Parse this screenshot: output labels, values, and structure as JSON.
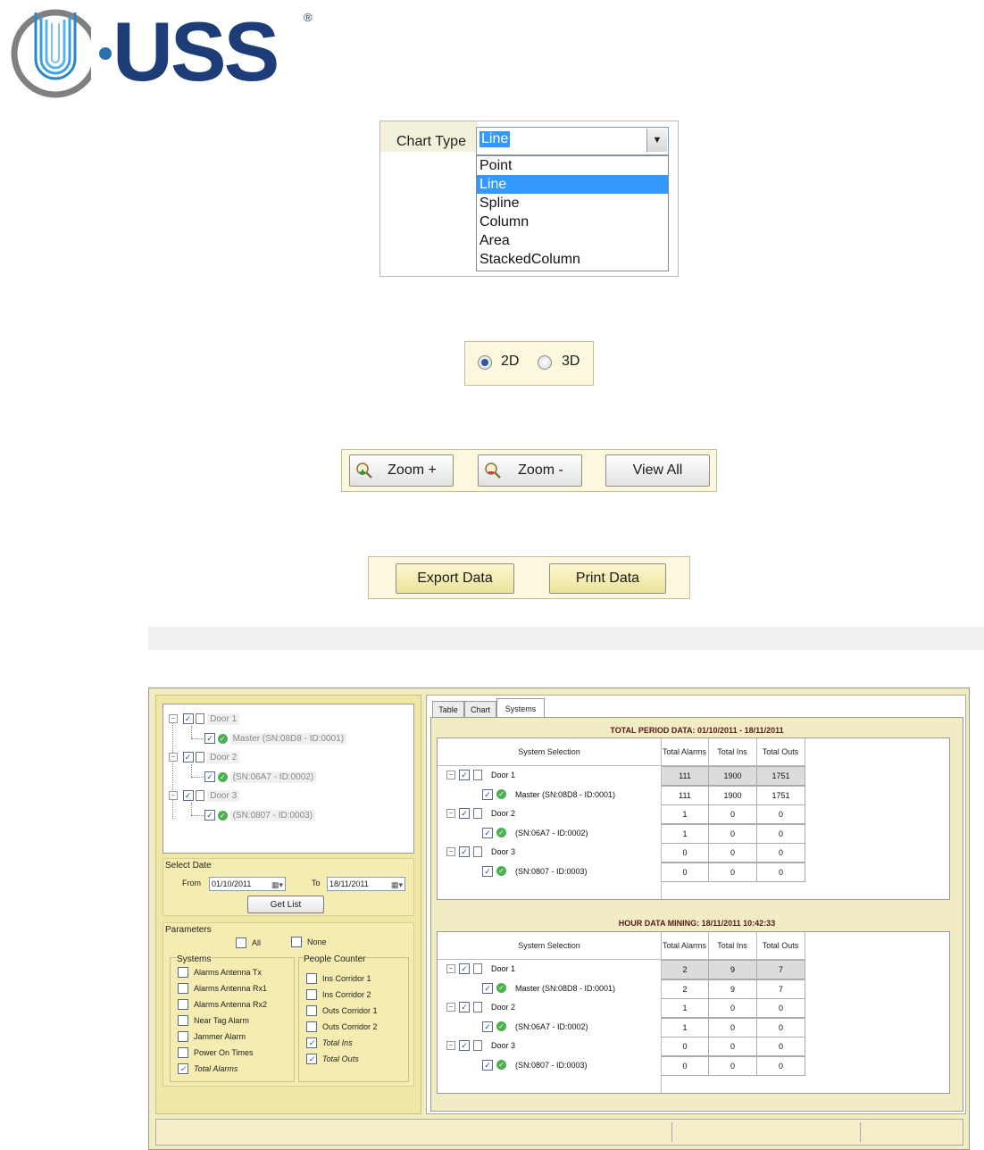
{
  "logo": {
    "text": "USS",
    "reg": "®"
  },
  "chart_type": {
    "label": "Chart Type",
    "value": "Line",
    "options": [
      "Point",
      "Line",
      "Spline",
      "Column",
      "Area",
      "StackedColumn"
    ],
    "selected_index": 1
  },
  "dimension": {
    "option_2d": "2D",
    "option_3d": "3D",
    "selected": "2D"
  },
  "zoom": {
    "zoom_in": "Zoom +",
    "zoom_out": "Zoom -",
    "view_all": "View All"
  },
  "export": {
    "export_label": "Export Data",
    "print_label": "Print Data"
  },
  "app": {
    "tree": [
      {
        "label": "Door 1",
        "child": "Master (SN:08D8 - ID:0001)"
      },
      {
        "label": "Door 2",
        "child": "(SN:06A7 - ID:0002)"
      },
      {
        "label": "Door 3",
        "child": "(SN:0807 - ID:0003)"
      }
    ],
    "select_date": {
      "title": "Select Date",
      "from_label": "From",
      "from_value": "01/10/2011",
      "to_label": "To",
      "to_value": "18/11/2011",
      "get_list": "Get List"
    },
    "parameters": {
      "title": "Parameters",
      "all": "All",
      "none": "None",
      "systems_title": "Systems",
      "systems": [
        {
          "label": "Alarms Antenna Tx",
          "checked": false
        },
        {
          "label": "Alarms Antenna Rx1",
          "checked": false
        },
        {
          "label": "Alarms Antenna Rx2",
          "checked": false
        },
        {
          "label": "Near Tag Alarm",
          "checked": false
        },
        {
          "label": "Jammer Alarm",
          "checked": false
        },
        {
          "label": "Power On Times",
          "checked": false
        },
        {
          "label": "Total Alarms",
          "checked": true
        }
      ],
      "people_title": "People Counter",
      "people": [
        {
          "label": "Ins Corridor 1",
          "checked": false
        },
        {
          "label": "Ins Corridor 2",
          "checked": false
        },
        {
          "label": "Outs Corridor 1",
          "checked": false
        },
        {
          "label": "Outs Corridor 2",
          "checked": false
        },
        {
          "label": "Total Ins",
          "checked": true
        },
        {
          "label": "Total Outs",
          "checked": true
        }
      ]
    },
    "tabs": [
      "Table",
      "Chart",
      "Systems"
    ],
    "active_tab": "Systems",
    "grid_headers": {
      "system": "System Selection",
      "alarms": "Total Alarms",
      "ins": "Total Ins",
      "outs": "Total Outs"
    },
    "total_period": {
      "title": "TOTAL PERIOD DATA: 01/10/2011 - 18/11/2011",
      "rows": [
        {
          "label": "Door 1",
          "alarms": "111",
          "ins": "1900",
          "outs": "1751"
        },
        {
          "label": "Master (SN:08D8 - ID:0001)",
          "alarms": "111",
          "ins": "1900",
          "outs": "1751"
        },
        {
          "label": "Door 2",
          "alarms": "1",
          "ins": "0",
          "outs": "0"
        },
        {
          "label": "(SN:06A7 - ID:0002)",
          "alarms": "1",
          "ins": "0",
          "outs": "0"
        },
        {
          "label": "Door 3",
          "alarms": "0",
          "ins": "0",
          "outs": "0"
        },
        {
          "label": "(SN:0807 - ID:0003)",
          "alarms": "0",
          "ins": "0",
          "outs": "0"
        }
      ]
    },
    "hour_data": {
      "title": "HOUR DATA MINING: 18/11/2011 10:42:33",
      "rows": [
        {
          "label": "Door 1",
          "alarms": "2",
          "ins": "9",
          "outs": "7"
        },
        {
          "label": "Master (SN:08D8 - ID:0001)",
          "alarms": "2",
          "ins": "9",
          "outs": "7"
        },
        {
          "label": "Door 2",
          "alarms": "1",
          "ins": "0",
          "outs": "0"
        },
        {
          "label": "(SN:06A7 - ID:0002)",
          "alarms": "1",
          "ins": "0",
          "outs": "0"
        },
        {
          "label": "Door 3",
          "alarms": "0",
          "ins": "0",
          "outs": "0"
        },
        {
          "label": "(SN:0807 - ID:0003)",
          "alarms": "0",
          "ins": "0",
          "outs": "0"
        }
      ]
    }
  }
}
